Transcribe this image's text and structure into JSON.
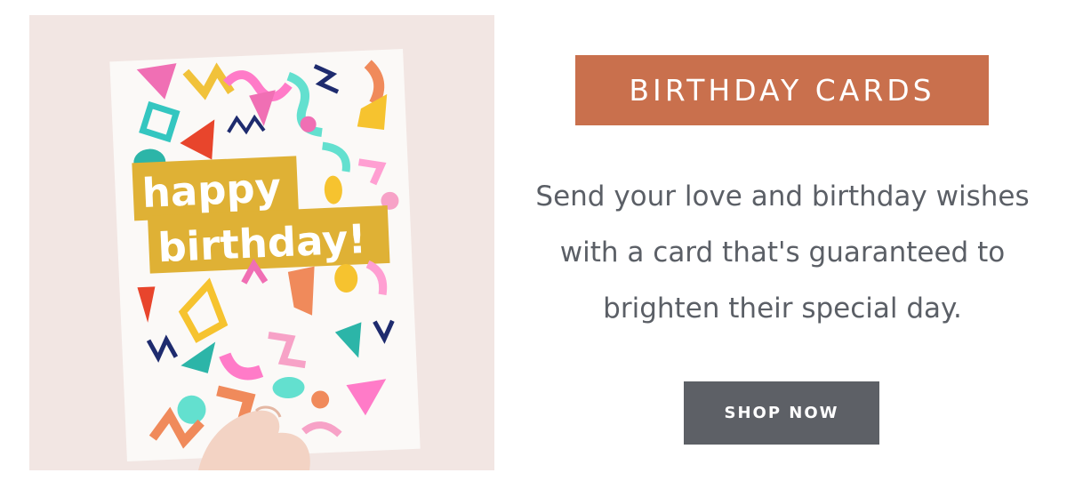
{
  "photo": {
    "card_text_line1": "happy",
    "card_text_line2": "birthday!"
  },
  "promo_tag": {
    "label": "BIRTHDAY CARDS"
  },
  "description": {
    "line1": "Send your love and birthday wishes",
    "line2": "with a card that's guaranteed to",
    "line3": "brighten their special day."
  },
  "shop_button": {
    "label": "SHOP NOW"
  },
  "colors": {
    "tag_background": "#c9704d",
    "button_background": "#5d6066",
    "text": "#5b5f66",
    "card_banner": "#dfb135"
  }
}
